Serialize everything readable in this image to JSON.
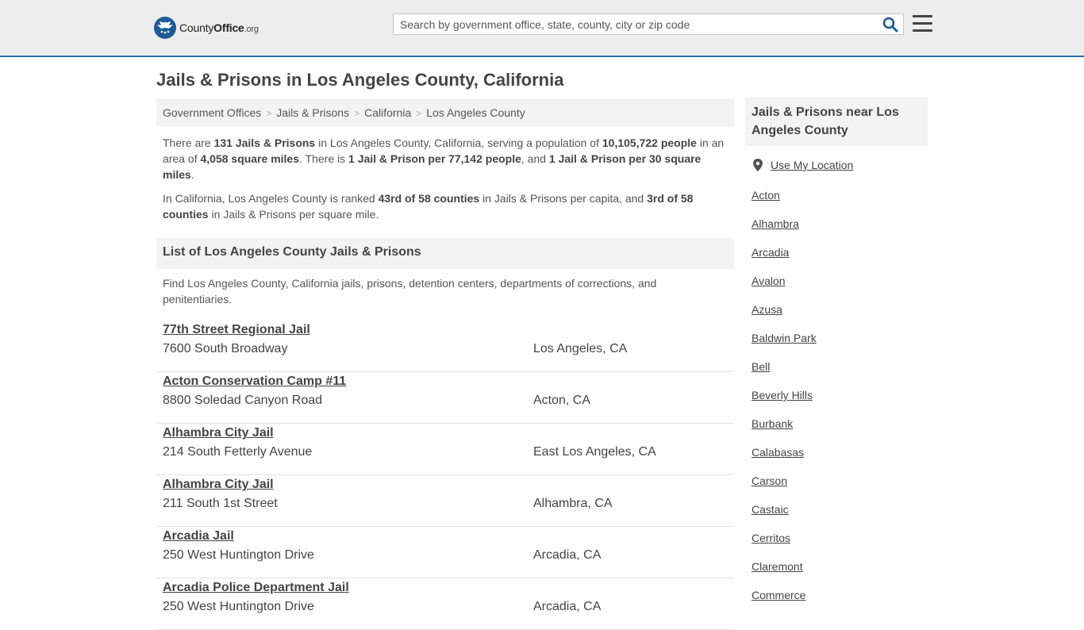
{
  "header": {
    "logo_main": "County",
    "logo_bold": "Office",
    "logo_org": ".org",
    "search_placeholder": "Search by government office, state, county, city or zip code",
    "brand_color": "#1d5b9b"
  },
  "page_title": "Jails & Prisons in Los Angeles County, California",
  "breadcrumb": [
    "Government Offices",
    "Jails & Prisons",
    "California",
    "Los Angeles County"
  ],
  "intro": {
    "p1": [
      {
        "t": "There are ",
        "b": false
      },
      {
        "t": "131 Jails & Prisons",
        "b": true
      },
      {
        "t": " in Los Angeles County, California, serving a population of ",
        "b": false
      },
      {
        "t": "10,105,722 people",
        "b": true
      },
      {
        "t": " in an area of ",
        "b": false
      },
      {
        "t": "4,058 square miles",
        "b": true
      },
      {
        "t": ". There is ",
        "b": false
      },
      {
        "t": "1 Jail & Prison per 77,142 people",
        "b": true
      },
      {
        "t": ", and ",
        "b": false
      },
      {
        "t": "1 Jail & Prison per 30 square miles",
        "b": true
      },
      {
        "t": ".",
        "b": false
      }
    ],
    "p2": [
      {
        "t": "In California, Los Angeles County is ranked ",
        "b": false
      },
      {
        "t": "43rd of 58 counties",
        "b": true
      },
      {
        "t": " in Jails & Prisons per capita, and ",
        "b": false
      },
      {
        "t": "3rd of 58 counties",
        "b": true
      },
      {
        "t": " in Jails & Prisons per square mile.",
        "b": false
      }
    ]
  },
  "list": {
    "heading": "List of Los Angeles County Jails & Prisons",
    "description": "Find Los Angeles County, California jails, prisons, detention centers, departments of corrections, and penitentiaries.",
    "entries": [
      {
        "name": "77th Street Regional Jail",
        "address": "7600 South Broadway",
        "city": "Los Angeles, CA"
      },
      {
        "name": "Acton Conservation Camp #11",
        "address": "8800 Soledad Canyon Road",
        "city": "Acton, CA"
      },
      {
        "name": "Alhambra City Jail",
        "address": "214 South Fetterly Avenue",
        "city": "East Los Angeles, CA"
      },
      {
        "name": "Alhambra City Jail",
        "address": "211 South 1st Street",
        "city": "Alhambra, CA"
      },
      {
        "name": "Arcadia Jail",
        "address": "250 West Huntington Drive",
        "city": "Arcadia, CA"
      },
      {
        "name": "Arcadia Police Department Jail",
        "address": "250 West Huntington Drive",
        "city": "Arcadia, CA"
      }
    ]
  },
  "sidebar": {
    "heading": "Jails & Prisons near Los Angeles County",
    "use_location": "Use My Location",
    "links": [
      "Acton",
      "Alhambra",
      "Arcadia",
      "Avalon",
      "Azusa",
      "Baldwin Park",
      "Bell",
      "Beverly Hills",
      "Burbank",
      "Calabasas",
      "Carson",
      "Castaic",
      "Cerritos",
      "Claremont",
      "Commerce"
    ]
  }
}
